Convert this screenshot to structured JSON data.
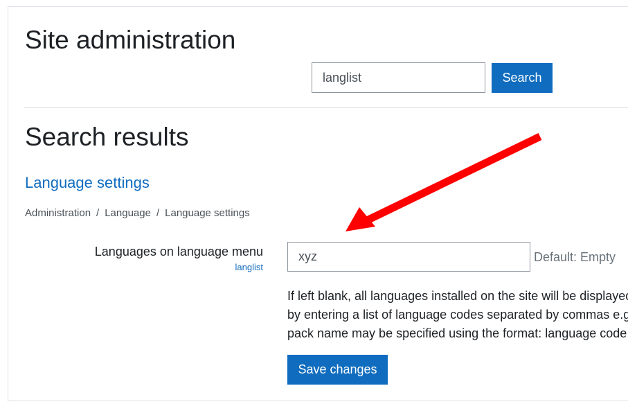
{
  "header": {
    "title": "Site administration"
  },
  "search": {
    "value": "langlist",
    "button_label": "Search"
  },
  "results": {
    "title": "Search results",
    "section_link": "Language settings",
    "breadcrumb": [
      "Administration",
      "Language",
      "Language settings"
    ],
    "breadcrumb_separator": "/"
  },
  "setting": {
    "label": "Languages on language menu",
    "name": "langlist",
    "value": "xyz",
    "default_text": "Default: Empty",
    "description_lines": [
      "If left blank, all languages installed on the site will be displayed",
      "by entering a list of language codes separated by commas e.g",
      "pack name may be specified using the format: language code"
    ],
    "save_label": "Save changes"
  },
  "colors": {
    "primary": "#0f6cbf",
    "annotation_arrow": "#ff0000"
  },
  "icons": {
    "annotation": "red-arrow-icon"
  }
}
